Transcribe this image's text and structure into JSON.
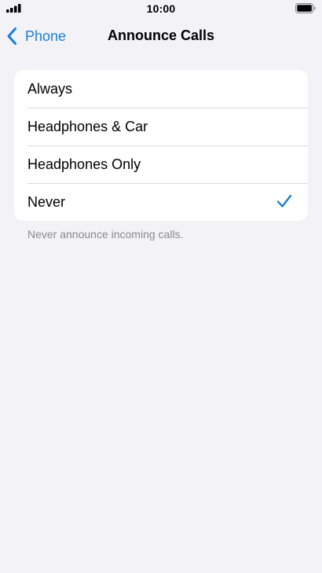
{
  "status_bar": {
    "time": "10:00"
  },
  "nav": {
    "back_label": "Phone",
    "title": "Announce Calls"
  },
  "options": [
    {
      "label": "Always",
      "selected": false
    },
    {
      "label": "Headphones & Car",
      "selected": false
    },
    {
      "label": "Headphones Only",
      "selected": false
    },
    {
      "label": "Never",
      "selected": true
    }
  ],
  "footer_note": "Never announce incoming calls.",
  "colors": {
    "accent": "#1a7fd6",
    "background": "#f2f2f7",
    "secondary_text": "#8a8a8e"
  },
  "icons": {
    "signal": "cellular-signal-icon",
    "battery": "battery-icon",
    "back": "chevron-left-icon",
    "selected": "checkmark-icon"
  }
}
